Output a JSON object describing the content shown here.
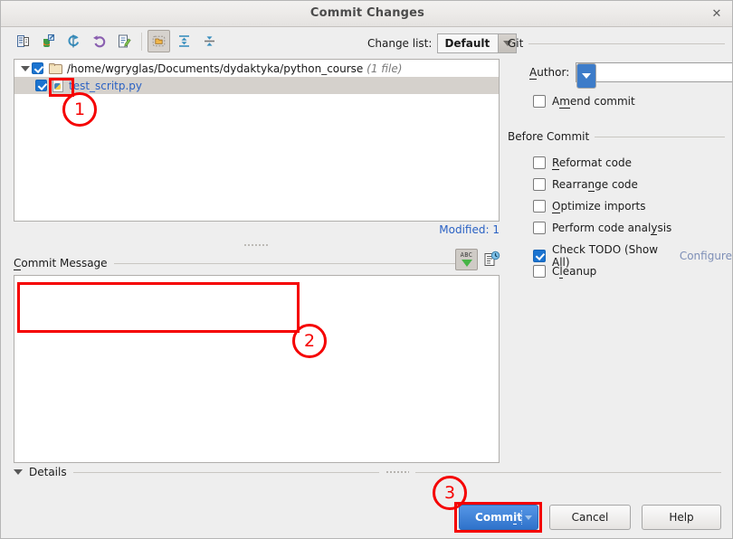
{
  "window": {
    "title": "Commit Changes",
    "close_icon": "close-icon"
  },
  "toolbar": {
    "icons": [
      {
        "name": "show-diff-icon",
        "label": "Show Diff"
      },
      {
        "name": "revert-arrow-icon",
        "label": "Move to Another Changelist"
      },
      {
        "name": "refresh-icon",
        "label": "Refresh"
      },
      {
        "name": "rollback-icon",
        "label": "Rollback"
      },
      {
        "name": "edit-source-icon",
        "label": "Edit Source"
      },
      {
        "name": "group-by-directory-icon",
        "label": "Group by Directory"
      },
      {
        "name": "expand-all-icon",
        "label": "Expand All"
      },
      {
        "name": "collapse-all-icon",
        "label": "Collapse All"
      }
    ],
    "changelist_label": "Change list:",
    "changelist_value": "Default"
  },
  "tree": {
    "root_path": "/home/wgryglas/Documents/dydaktyka/python_course",
    "root_count": "(1 file)",
    "file_name": "test_scritp.py",
    "root_checked": true,
    "file_checked": true
  },
  "status": {
    "modified_label": "Modified:",
    "modified_count": "1"
  },
  "commit_message": {
    "header": "Commit Message",
    "value": "",
    "spellcheck_icon": "spellcheck-abc-icon",
    "history_icon": "message-history-icon"
  },
  "details": {
    "label": "Details",
    "expanded": true
  },
  "git_panel": {
    "group_title": "Git",
    "author_label": "Author:",
    "author_value": "",
    "amend_label": "Amend commit",
    "amend_checked": false
  },
  "before_commit": {
    "group_title": "Before Commit",
    "items": [
      {
        "label": "Reformat code",
        "checked": false,
        "underline": "R"
      },
      {
        "label": "Rearrange code",
        "checked": false,
        "underline": "n"
      },
      {
        "label": "Optimize imports",
        "checked": false,
        "underline": "O"
      },
      {
        "label": "Perform code analysis",
        "checked": false,
        "underline": "y"
      },
      {
        "label": "Check TODO (Show All)",
        "checked": true,
        "link": "Configure"
      },
      {
        "label": "Cleanup",
        "checked": false,
        "underline": "l"
      }
    ]
  },
  "buttons": {
    "commit": "Commit",
    "cancel": "Cancel",
    "help": "Help"
  },
  "annotations": [
    {
      "id": "1",
      "target": "file-checkbox"
    },
    {
      "id": "2",
      "target": "commit-message-input"
    },
    {
      "id": "3",
      "target": "commit-button"
    }
  ],
  "colors": {
    "accent_blue": "#2f72ca",
    "annotation_red": "#f50000",
    "link_blue": "#2b62c4",
    "selection_gray": "#d5d1cc"
  }
}
